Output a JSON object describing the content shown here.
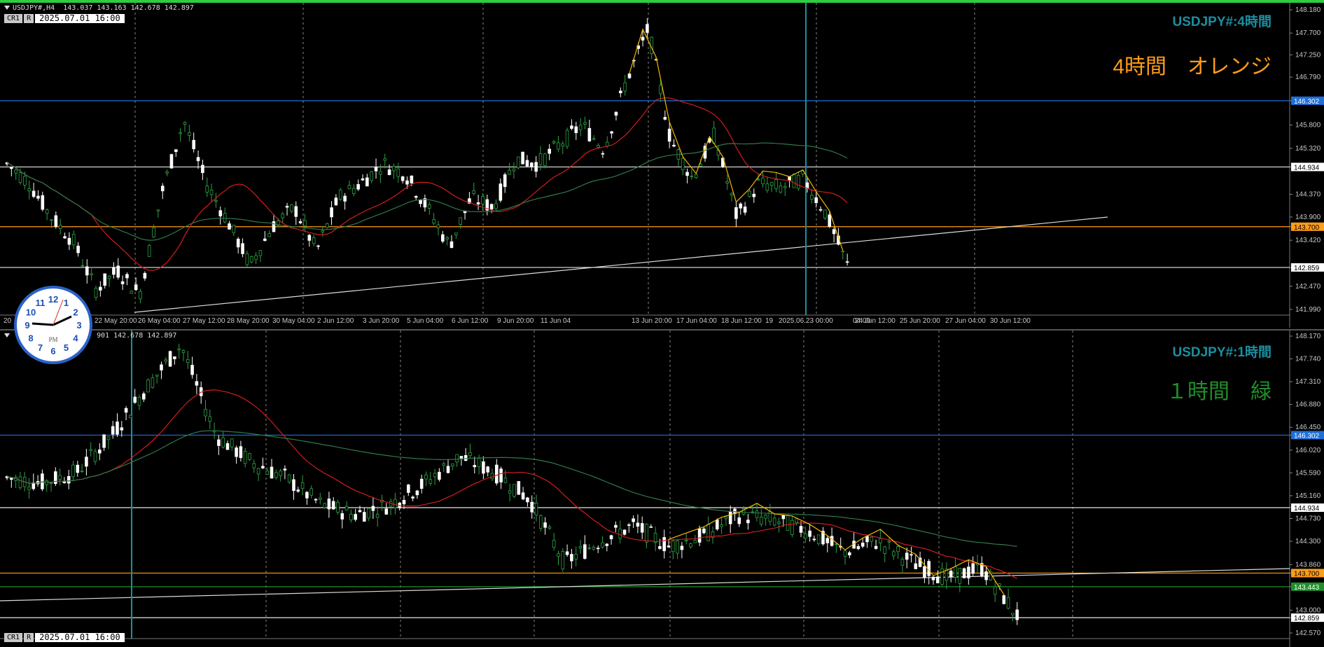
{
  "top_pane": {
    "header": "USDJPY#,H4  143.037 143.163 142.678 142.897",
    "cr": "CR1",
    "r": "R",
    "datetime": "2025.07.01 16:00",
    "symbol_title": "USDJPY#:4時間",
    "label": "4時間　オレンジ",
    "label_color": "#ff9c1a",
    "y_ticks": [
      "148.180",
      "147.700",
      "147.250",
      "146.790",
      "146.302",
      "145.800",
      "145.320",
      "144.934",
      "144.370",
      "143.900",
      "143.700",
      "143.420",
      "142.859",
      "142.470",
      "141.990"
    ],
    "x_ticks": [
      "20",
      "22 May 20:00",
      "26 May 04:00",
      "27 May 12:00",
      "28 May 20:00",
      "30 May 04:00",
      "2 Jun 12:00",
      "3 Jun 20:00",
      "5 Jun 04:00",
      "6 Jun 12:00",
      "9 Jun 20:00",
      "11 Jun 04",
      "13 Jun 20:00",
      "17 Jun 04:00",
      "18 Jun 12:00",
      "19",
      "2025.06.23 00:00",
      "04:00",
      "24 Jun 12:00",
      "25 Jun 20:00",
      "27 Jun 04:00",
      "30 Jun 12:00"
    ]
  },
  "bottom_pane": {
    "header": "901 142.678 142.897",
    "cr": "CR1",
    "r": "R",
    "datetime": "2025.07.01 16:00",
    "symbol_title": "USDJPY#:1時間",
    "label": "１時間　緑",
    "label_color": "#1f8f2a",
    "y_ticks": [
      "148.170",
      "147.740",
      "147.310",
      "146.880",
      "146.450",
      "146.302",
      "146.020",
      "145.590",
      "145.160",
      "144.934",
      "144.730",
      "144.300",
      "143.860",
      "143.700",
      "143.443",
      "143.000",
      "142.859",
      "142.570"
    ]
  },
  "price_lines": {
    "blue": "146.302",
    "white_top": "144.934",
    "orange": "143.700",
    "white_bottom": "142.859",
    "green": "143.443"
  },
  "colors": {
    "blue": "#1e6fd9",
    "orange": "#ff9c1a",
    "green_line": "#1f8f2a",
    "white": "#e6e6e6",
    "red_ma": "#d21e1e",
    "green_ma": "#2f7a4a",
    "zigzag": "#f5b800",
    "cursor": "#1b8fa0"
  },
  "clock": {
    "numbers": [
      "12",
      "1",
      "2",
      "3",
      "4",
      "5",
      "6",
      "7",
      "8",
      "9",
      "10",
      "11"
    ],
    "ampm": "PM"
  }
}
